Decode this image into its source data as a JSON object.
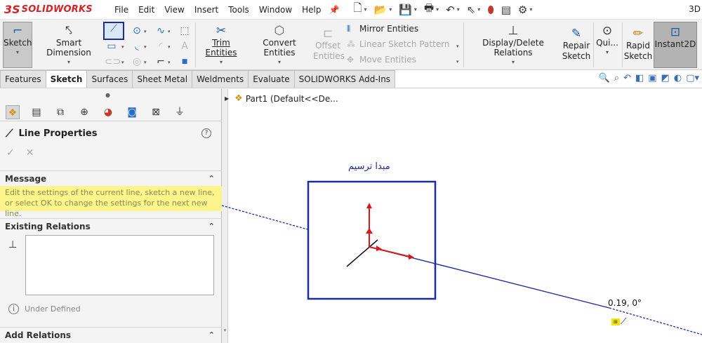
{
  "app": {
    "logo_mark": "3S",
    "logo_text": "SOLIDWORKS",
    "view_hint": "3D"
  },
  "menu": {
    "items": [
      "File",
      "Edit",
      "View",
      "Insert",
      "Tools",
      "Window",
      "Help"
    ]
  },
  "ribbon": {
    "sketch": "Sketch",
    "smart_dimension": "Smart Dimension",
    "trim_entities": "Trim Entities",
    "convert_entities": "Convert Entities",
    "offset_entities_1": "Offset",
    "offset_entities_2": "Entities",
    "mirror_entities": "Mirror Entities",
    "linear_sketch_pattern": "Linear Sketch Pattern",
    "move_entities": "Move Entities",
    "display_delete_relations": "Display/Delete Relations",
    "repair_sketch_1": "Repair",
    "repair_sketch_2": "Sketch",
    "quick_snaps": "Qui...",
    "rapid_sketch_1": "Rapid",
    "rapid_sketch_2": "Sketch",
    "instant2d": "Instant2D"
  },
  "tabs": [
    "Features",
    "Sketch",
    "Surfaces",
    "Sheet Metal",
    "Weldments",
    "Evaluate",
    "SOLIDWORKS Add-Ins"
  ],
  "active_tab": "Sketch",
  "property_manager": {
    "title": "Line Properties",
    "help": "?",
    "ok": "✓",
    "cancel": "✕",
    "message_header": "Message",
    "message_text": "Edit the settings of the current line, sketch a new line, or select OK to change the settings for the next new line.",
    "existing_relations_header": "Existing Relations",
    "status": "Under Defined",
    "add_relations_header": "Add Relations"
  },
  "tree": {
    "part_label": "Part1  (Default<<De..."
  },
  "canvas": {
    "annotation": "مبدا ترسیم",
    "dimension": "0.19, 0°"
  },
  "colors": {
    "brand": "#d6232a",
    "sketch_line": "#1c2c9c",
    "origin_arrow": "#d7191c",
    "message_bg": "#fdf58c"
  }
}
